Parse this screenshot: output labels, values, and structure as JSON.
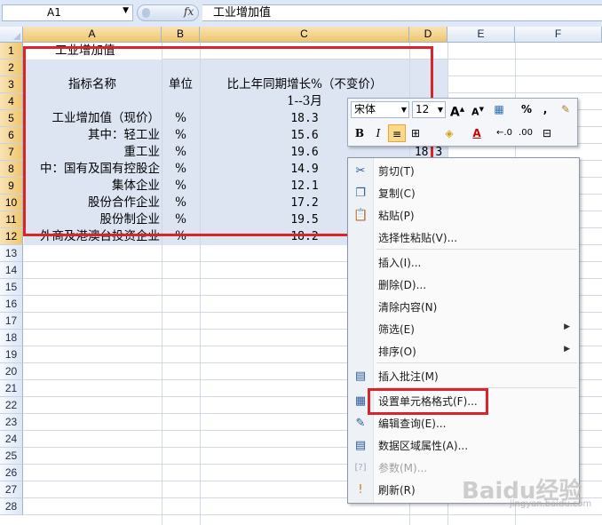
{
  "formula_bar": {
    "name_box": "A1",
    "fx_label": "fx",
    "content": "工业增加值"
  },
  "columns": [
    "A",
    "B",
    "C",
    "D",
    "E",
    "F"
  ],
  "rows": [
    "1",
    "2",
    "3",
    "4",
    "5",
    "6",
    "7",
    "8",
    "9",
    "10",
    "11",
    "12",
    "13",
    "14",
    "15",
    "16",
    "17",
    "18",
    "19",
    "20",
    "21",
    "22",
    "23",
    "24",
    "25",
    "26",
    "27",
    "28"
  ],
  "sheet": {
    "r1": {
      "a": "工业增加值"
    },
    "r3": {
      "a": "指标名称",
      "b": "单位",
      "c": "比上年同期增长%（不变价）"
    },
    "r4": {
      "c": "1--3月"
    },
    "body": [
      {
        "a": "工业增加值（现价）",
        "b": "%",
        "c": "18.3"
      },
      {
        "a": "其中：轻工业",
        "b": "%",
        "c": "15.6"
      },
      {
        "a": "重工业",
        "b": "%",
        "c": "19.6",
        "d": "18.3"
      },
      {
        "a": "中：国有及国有控股企",
        "b": "%",
        "c": "14.9"
      },
      {
        "a": "集体企业",
        "b": "%",
        "c": "12.1"
      },
      {
        "a": "股份合作企业",
        "b": "%",
        "c": "17.2"
      },
      {
        "a": "股份制企业",
        "b": "%",
        "c": "19.5"
      },
      {
        "a": "外商及港澳台投资企业",
        "b": "%",
        "c": "18.2"
      }
    ]
  },
  "mini_toolbar": {
    "font": "宋体",
    "size": "12",
    "grow": "A",
    "shrink": "A",
    "percent": "%",
    "comma": ",",
    "bold": "B",
    "italic": "I",
    "font_color": "A"
  },
  "context_menu": [
    {
      "label": "剪切(T)",
      "icon": "scissors-icon",
      "glyph": "✂"
    },
    {
      "label": "复制(C)",
      "icon": "copy-icon",
      "glyph": "❐"
    },
    {
      "label": "粘贴(P)",
      "icon": "paste-icon",
      "glyph": "📋"
    },
    {
      "label": "选择性粘贴(V)...",
      "icon": "",
      "glyph": ""
    },
    {
      "label": "插入(I)...",
      "icon": "",
      "glyph": ""
    },
    {
      "label": "删除(D)...",
      "icon": "",
      "glyph": ""
    },
    {
      "label": "清除内容(N)",
      "icon": "",
      "glyph": ""
    },
    {
      "label": "筛选(E)",
      "icon": "",
      "glyph": "",
      "submenu": true
    },
    {
      "label": "排序(O)",
      "icon": "",
      "glyph": "",
      "submenu": true
    },
    {
      "label": "插入批注(M)",
      "icon": "comment-icon",
      "glyph": "▤"
    },
    {
      "label": "设置单元格格式(F)...",
      "icon": "format-cells-icon",
      "glyph": "▦"
    },
    {
      "label": "编辑查询(E)...",
      "icon": "edit-query-icon",
      "glyph": "✎"
    },
    {
      "label": "数据区域属性(A)...",
      "icon": "data-range-icon",
      "glyph": "▤"
    },
    {
      "label": "参数(M)...",
      "icon": "parameters-icon",
      "glyph": "[?]",
      "disabled": true
    },
    {
      "label": "刷新(R)",
      "icon": "refresh-icon",
      "glyph": "!"
    }
  ],
  "watermark": {
    "logo": "Baidu经验",
    "url": "jingyan.baidu.com"
  },
  "colors": {
    "highlight": "#d8252b",
    "selection": "#dde5f3",
    "header_selected": "#f0c66d"
  }
}
